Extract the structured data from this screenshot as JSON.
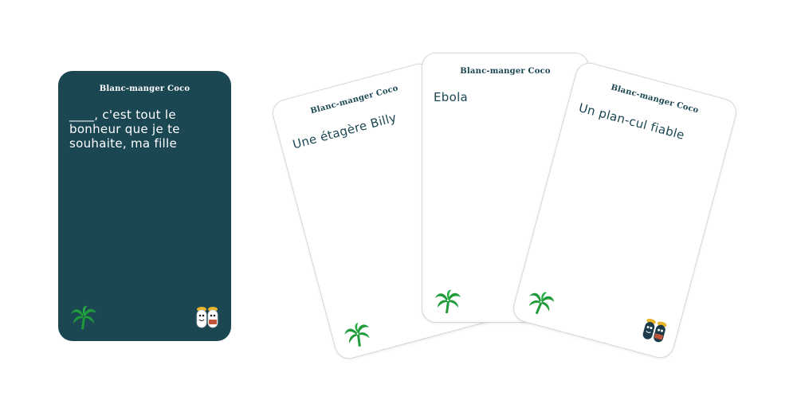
{
  "brand": "Blanc-manger Coco",
  "black_card": {
    "text": "____, c'est tout le bonheur que je te souhaite, ma fille"
  },
  "white_cards": [
    {
      "text": "Une étagère Billy"
    },
    {
      "text": "Ebola"
    },
    {
      "text": "Un plan-cul fiable"
    }
  ],
  "colors": {
    "card_dark": "#1b4753",
    "card_white": "#ffffff",
    "palm_green": "#1f9b3a",
    "text_dark": "#1b4753"
  },
  "icons": [
    "palm-tree-icon",
    "coco-mascots-icon"
  ]
}
